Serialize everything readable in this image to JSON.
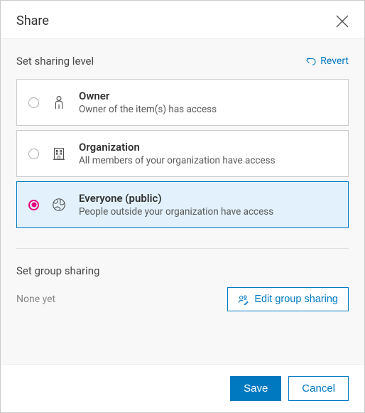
{
  "header": {
    "title": "Share"
  },
  "sharing": {
    "section_title": "Set sharing level",
    "revert_label": "Revert",
    "selected_index": 2,
    "options": [
      {
        "title": "Owner",
        "desc": "Owner of the item(s) has access"
      },
      {
        "title": "Organization",
        "desc": "All members of your organization have access"
      },
      {
        "title": "Everyone (public)",
        "desc": "People outside your organization have access"
      }
    ]
  },
  "group_sharing": {
    "section_title": "Set group sharing",
    "status": "None yet",
    "edit_label": "Edit group sharing"
  },
  "footer": {
    "save_label": "Save",
    "cancel_label": "Cancel"
  }
}
